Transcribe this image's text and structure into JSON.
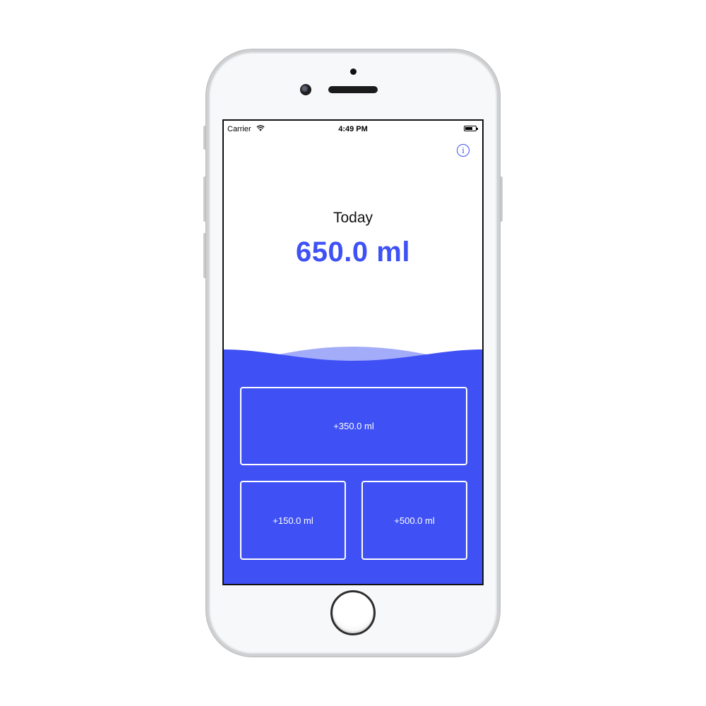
{
  "status_bar": {
    "carrier": "Carrier",
    "time": "4:49 PM",
    "wifi_icon": "wifi-icon",
    "battery_icon": "battery-icon"
  },
  "header": {
    "info_icon": "info-icon",
    "info_glyph": "i"
  },
  "summary": {
    "label": "Today",
    "total": "650.0 ml"
  },
  "water_level_fraction": 0.49,
  "actions": {
    "add_large": "+350.0 ml",
    "add_small": "+150.0 ml",
    "add_medium": "+500.0 ml"
  },
  "colors": {
    "accent": "#3f51f5",
    "wave_light": "#a3acf8",
    "button_border": "#ffffff"
  }
}
